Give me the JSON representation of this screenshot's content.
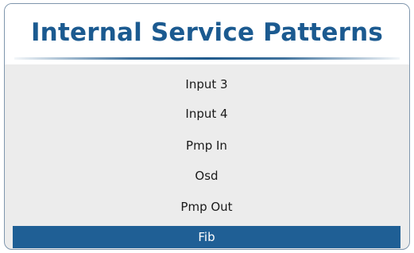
{
  "menu": {
    "title": "Internal Service Patterns",
    "items": [
      {
        "label": "Input 3",
        "selected": false
      },
      {
        "label": "Input 4",
        "selected": false
      },
      {
        "label": "Pmp In",
        "selected": false
      },
      {
        "label": "Osd",
        "selected": false
      },
      {
        "label": "Pmp Out",
        "selected": false
      },
      {
        "label": "Fib",
        "selected": true
      }
    ]
  },
  "colors": {
    "title": "#1b5a90",
    "selection": "#1f5f95",
    "background": "#ececec"
  }
}
